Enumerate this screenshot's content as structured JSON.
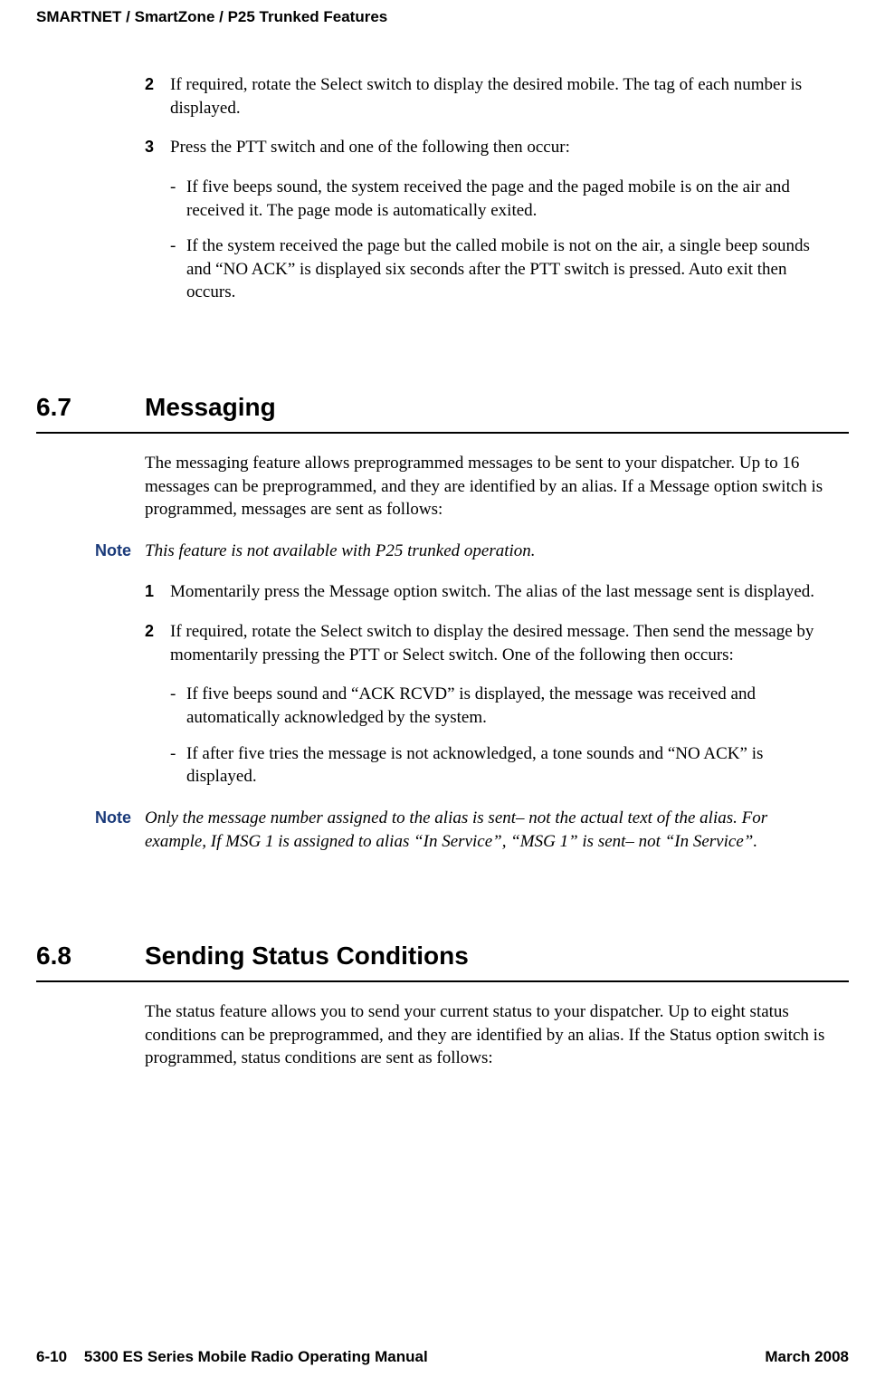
{
  "header": "SMARTNET / SmartZone / P25 Trunked Features",
  "steps_top": {
    "s2": {
      "num": "2",
      "text": "If required, rotate the Select switch to display the desired mobile. The tag of each number is displayed."
    },
    "s3": {
      "num": "3",
      "text": "Press the PTT switch and one of the following then occur:"
    },
    "bullets": {
      "b1": "If five beeps sound, the system received the page and the paged mobile is on the air and received it. The page mode is automatically exited.",
      "b2": "If the system received the page but the called mobile is not on the air, a single beep sounds and “NO ACK” is displayed six seconds after the PTT switch is pressed. Auto exit then occurs."
    }
  },
  "sec67": {
    "num": "6.7",
    "title": "Messaging",
    "intro": "The messaging feature allows preprogrammed messages to be sent to your dispatcher. Up to 16 messages can be preprogrammed, and they are identified by an alias. If a Message option switch is programmed, messages are sent as follows:",
    "note1_label": "Note",
    "note1_text": "This feature is not available with P25 trunked operation.",
    "s1": {
      "num": "1",
      "text": "Momentarily press the Message option switch. The alias of the last message sent is displayed."
    },
    "s2": {
      "num": "2",
      "text": "If required, rotate the Select switch to display the desired message. Then send the message by momentarily pressing the PTT or Select switch. One of the following then occurs:"
    },
    "bullets": {
      "b1": "If five beeps sound and “ACK RCVD” is displayed, the message was received and automatically acknowledged by the system.",
      "b2": "If after five tries the message is not acknowledged, a tone sounds and “NO ACK” is displayed."
    },
    "note2_label": "Note",
    "note2_text": "Only the message number assigned to the alias is sent– not the actual text of the alias. For example, If MSG 1 is assigned to alias “In Service”, “MSG 1” is sent– not “In Service”."
  },
  "sec68": {
    "num": "6.8",
    "title": "Sending Status Conditions",
    "intro": "The status feature allows you to send your current status to your dispatcher. Up to eight status conditions can be preprogrammed, and they are identified by an alias. If the Status option switch is programmed, status conditions are sent as follows:"
  },
  "footer": {
    "left": "6-10    5300 ES Series Mobile Radio Operating Manual",
    "right": "March 2008"
  }
}
